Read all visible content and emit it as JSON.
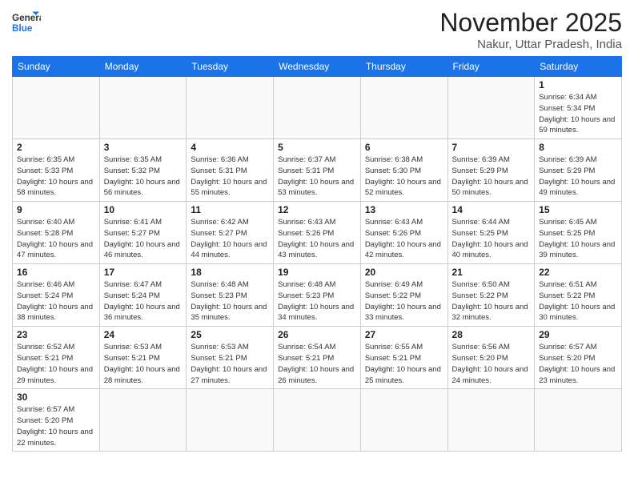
{
  "logo": {
    "line1": "General",
    "line2": "Blue"
  },
  "title": "November 2025",
  "location": "Nakur, Uttar Pradesh, India",
  "days_of_week": [
    "Sunday",
    "Monday",
    "Tuesday",
    "Wednesday",
    "Thursday",
    "Friday",
    "Saturday"
  ],
  "weeks": [
    [
      {
        "day": "",
        "info": ""
      },
      {
        "day": "",
        "info": ""
      },
      {
        "day": "",
        "info": ""
      },
      {
        "day": "",
        "info": ""
      },
      {
        "day": "",
        "info": ""
      },
      {
        "day": "",
        "info": ""
      },
      {
        "day": "1",
        "info": "Sunrise: 6:34 AM\nSunset: 5:34 PM\nDaylight: 10 hours and 59 minutes."
      }
    ],
    [
      {
        "day": "2",
        "info": "Sunrise: 6:35 AM\nSunset: 5:33 PM\nDaylight: 10 hours and 58 minutes."
      },
      {
        "day": "3",
        "info": "Sunrise: 6:35 AM\nSunset: 5:32 PM\nDaylight: 10 hours and 56 minutes."
      },
      {
        "day": "4",
        "info": "Sunrise: 6:36 AM\nSunset: 5:31 PM\nDaylight: 10 hours and 55 minutes."
      },
      {
        "day": "5",
        "info": "Sunrise: 6:37 AM\nSunset: 5:31 PM\nDaylight: 10 hours and 53 minutes."
      },
      {
        "day": "6",
        "info": "Sunrise: 6:38 AM\nSunset: 5:30 PM\nDaylight: 10 hours and 52 minutes."
      },
      {
        "day": "7",
        "info": "Sunrise: 6:39 AM\nSunset: 5:29 PM\nDaylight: 10 hours and 50 minutes."
      },
      {
        "day": "8",
        "info": "Sunrise: 6:39 AM\nSunset: 5:29 PM\nDaylight: 10 hours and 49 minutes."
      }
    ],
    [
      {
        "day": "9",
        "info": "Sunrise: 6:40 AM\nSunset: 5:28 PM\nDaylight: 10 hours and 47 minutes."
      },
      {
        "day": "10",
        "info": "Sunrise: 6:41 AM\nSunset: 5:27 PM\nDaylight: 10 hours and 46 minutes."
      },
      {
        "day": "11",
        "info": "Sunrise: 6:42 AM\nSunset: 5:27 PM\nDaylight: 10 hours and 44 minutes."
      },
      {
        "day": "12",
        "info": "Sunrise: 6:43 AM\nSunset: 5:26 PM\nDaylight: 10 hours and 43 minutes."
      },
      {
        "day": "13",
        "info": "Sunrise: 6:43 AM\nSunset: 5:26 PM\nDaylight: 10 hours and 42 minutes."
      },
      {
        "day": "14",
        "info": "Sunrise: 6:44 AM\nSunset: 5:25 PM\nDaylight: 10 hours and 40 minutes."
      },
      {
        "day": "15",
        "info": "Sunrise: 6:45 AM\nSunset: 5:25 PM\nDaylight: 10 hours and 39 minutes."
      }
    ],
    [
      {
        "day": "16",
        "info": "Sunrise: 6:46 AM\nSunset: 5:24 PM\nDaylight: 10 hours and 38 minutes."
      },
      {
        "day": "17",
        "info": "Sunrise: 6:47 AM\nSunset: 5:24 PM\nDaylight: 10 hours and 36 minutes."
      },
      {
        "day": "18",
        "info": "Sunrise: 6:48 AM\nSunset: 5:23 PM\nDaylight: 10 hours and 35 minutes."
      },
      {
        "day": "19",
        "info": "Sunrise: 6:48 AM\nSunset: 5:23 PM\nDaylight: 10 hours and 34 minutes."
      },
      {
        "day": "20",
        "info": "Sunrise: 6:49 AM\nSunset: 5:22 PM\nDaylight: 10 hours and 33 minutes."
      },
      {
        "day": "21",
        "info": "Sunrise: 6:50 AM\nSunset: 5:22 PM\nDaylight: 10 hours and 32 minutes."
      },
      {
        "day": "22",
        "info": "Sunrise: 6:51 AM\nSunset: 5:22 PM\nDaylight: 10 hours and 30 minutes."
      }
    ],
    [
      {
        "day": "23",
        "info": "Sunrise: 6:52 AM\nSunset: 5:21 PM\nDaylight: 10 hours and 29 minutes."
      },
      {
        "day": "24",
        "info": "Sunrise: 6:53 AM\nSunset: 5:21 PM\nDaylight: 10 hours and 28 minutes."
      },
      {
        "day": "25",
        "info": "Sunrise: 6:53 AM\nSunset: 5:21 PM\nDaylight: 10 hours and 27 minutes."
      },
      {
        "day": "26",
        "info": "Sunrise: 6:54 AM\nSunset: 5:21 PM\nDaylight: 10 hours and 26 minutes."
      },
      {
        "day": "27",
        "info": "Sunrise: 6:55 AM\nSunset: 5:21 PM\nDaylight: 10 hours and 25 minutes."
      },
      {
        "day": "28",
        "info": "Sunrise: 6:56 AM\nSunset: 5:20 PM\nDaylight: 10 hours and 24 minutes."
      },
      {
        "day": "29",
        "info": "Sunrise: 6:57 AM\nSunset: 5:20 PM\nDaylight: 10 hours and 23 minutes."
      }
    ],
    [
      {
        "day": "30",
        "info": "Sunrise: 6:57 AM\nSunset: 5:20 PM\nDaylight: 10 hours and 22 minutes."
      },
      {
        "day": "",
        "info": ""
      },
      {
        "day": "",
        "info": ""
      },
      {
        "day": "",
        "info": ""
      },
      {
        "day": "",
        "info": ""
      },
      {
        "day": "",
        "info": ""
      },
      {
        "day": "",
        "info": ""
      }
    ]
  ]
}
